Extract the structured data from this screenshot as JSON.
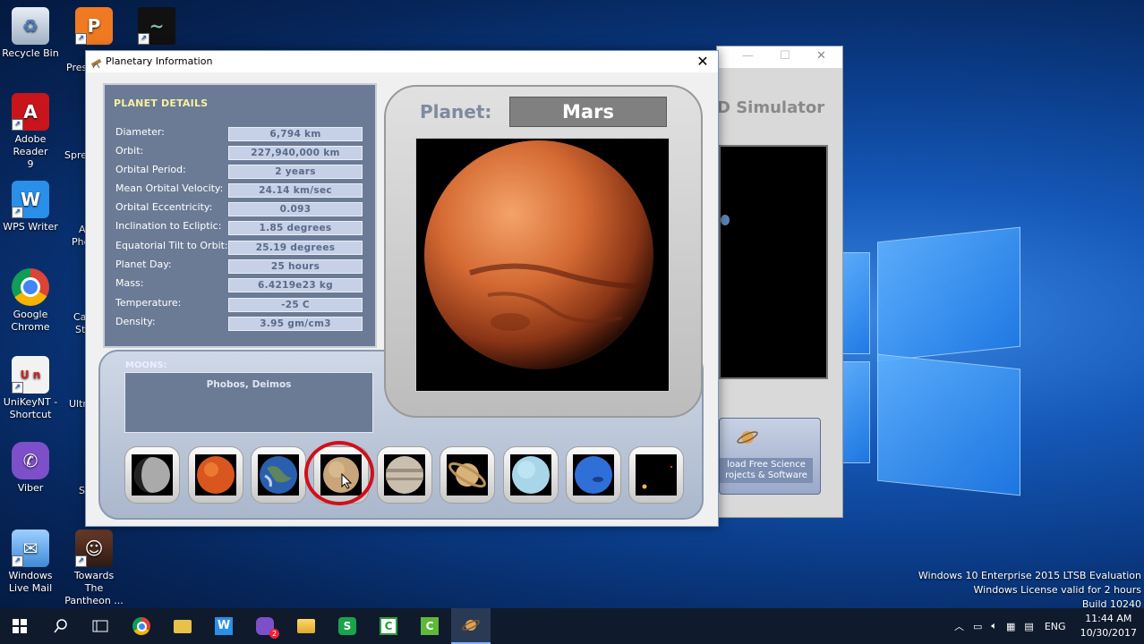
{
  "desktop": {
    "icons": [
      {
        "label": "Recycle Bin",
        "icon": "recycle-bin-icon"
      },
      {
        "label": "Adobe Reader 9",
        "icon": "adobe-reader-icon"
      },
      {
        "label": "WPS Writer",
        "icon": "wps-writer-icon"
      },
      {
        "label": "Google Chrome",
        "icon": "chrome-icon"
      },
      {
        "label": "UniKeyNT - Shortcut",
        "icon": "unikey-icon"
      },
      {
        "label": "Viber",
        "icon": "viber-icon"
      },
      {
        "label": "Windows Live Mail",
        "icon": "mail-icon"
      },
      {
        "label": "Towards The Pantheon ...",
        "icon": "game-icon"
      }
    ],
    "partial_labels": [
      "Pres",
      "Sprea",
      "A",
      "Pho",
      "Ca",
      "St",
      "Ultr",
      "S"
    ]
  },
  "bg_window": {
    "title_fragment": "D Simulator",
    "download_text": "load Free Science rojects & Software"
  },
  "dialog": {
    "title": "Planetary Information",
    "close_label": "✕",
    "details_heading": "PLANET DETAILS",
    "rows": [
      {
        "label": "Diameter:",
        "value": "6,794 km"
      },
      {
        "label": "Orbit:",
        "value": "227,940,000 km"
      },
      {
        "label": "Orbital Period:",
        "value": "2 years"
      },
      {
        "label": "Mean Orbital Velocity:",
        "value": "24.14 km/sec"
      },
      {
        "label": "Orbital  Eccentricity:",
        "value": "0.093"
      },
      {
        "label": "Inclination to Ecliptic:",
        "value": "1.85 degrees"
      },
      {
        "label": "Equatorial Tilt to Orbit:",
        "value": "25.19 degrees"
      },
      {
        "label": "Planet Day:",
        "value": "25 hours"
      },
      {
        "label": "Mass:",
        "value": "6.4219e23 kg"
      },
      {
        "label": "Temperature:",
        "value": "-25 C"
      },
      {
        "label": "Density:",
        "value": "3.95 gm/cm3"
      }
    ],
    "moons_heading": "MOONS:",
    "moons_value": "Phobos, Deimos",
    "planet_label": "Planet:",
    "planet_name": "Mars",
    "planet_buttons": [
      "mercury",
      "venus",
      "earth",
      "mars",
      "jupiter",
      "saturn",
      "uranus",
      "neptune",
      "pluto"
    ],
    "selected_planet": "mars"
  },
  "watermark": {
    "line1": "Windows 10 Enterprise 2015 LTSB Evaluation",
    "line2": "Windows License valid for 2 hours",
    "line3": "Build 10240"
  },
  "taskbar": {
    "apps": [
      "start-icon",
      "search-icon",
      "task-view-icon",
      "chrome-icon",
      "folder-icon",
      "wps-icon",
      "viber-icon",
      "file-explorer-icon",
      "spreadsheet-icon",
      "camtasia-icon",
      "camtasia-recorder-icon",
      "solar-system-icon"
    ],
    "viber_badge": "2",
    "language": "ENG",
    "time": "11:44 AM",
    "date": "10/30/2017"
  },
  "colors": {
    "panel_blue": "#6b7b95",
    "value_bg": "#c6d0e6",
    "heading_yellow": "#f7f0a0",
    "highlight_red": "#d0101a"
  }
}
